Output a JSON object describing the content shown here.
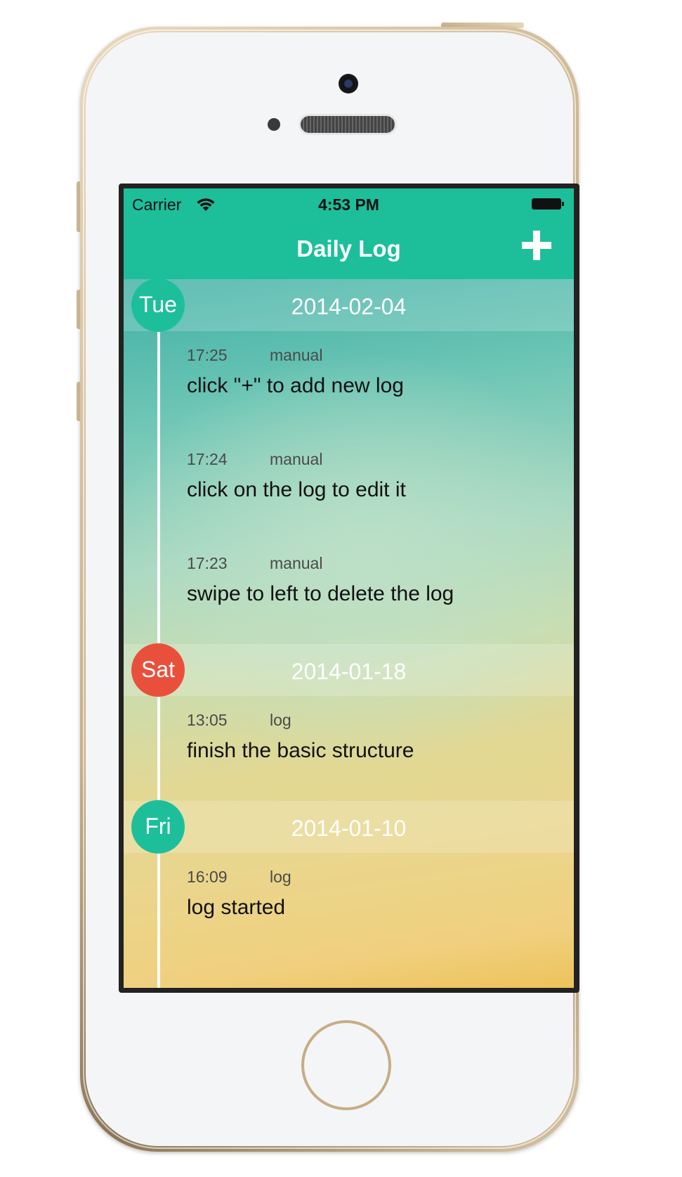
{
  "status_bar": {
    "carrier": "Carrier",
    "time": "4:53 PM"
  },
  "navbar": {
    "title": "Daily Log",
    "add_icon": "plus-icon"
  },
  "colors": {
    "accent": "#1dbf9b",
    "badge_green": "#1dbf9b",
    "badge_red": "#e9503c"
  },
  "days": [
    {
      "day": "Tue",
      "date": "2014-02-04",
      "badge_color": "#1dbf9b",
      "entries": [
        {
          "time": "17:25",
          "type": "manual",
          "text": "click \"+\" to add new log"
        },
        {
          "time": "17:24",
          "type": "manual",
          "text": "click on the log to edit it"
        },
        {
          "time": "17:23",
          "type": "manual",
          "text": "swipe to left to delete the log"
        }
      ]
    },
    {
      "day": "Sat",
      "date": "2014-01-18",
      "badge_color": "#e9503c",
      "entries": [
        {
          "time": "13:05",
          "type": "log",
          "text": "finish the basic structure"
        }
      ]
    },
    {
      "day": "Fri",
      "date": "2014-01-10",
      "badge_color": "#1dbf9b",
      "entries": [
        {
          "time": "16:09",
          "type": "log",
          "text": "log started"
        }
      ]
    }
  ]
}
